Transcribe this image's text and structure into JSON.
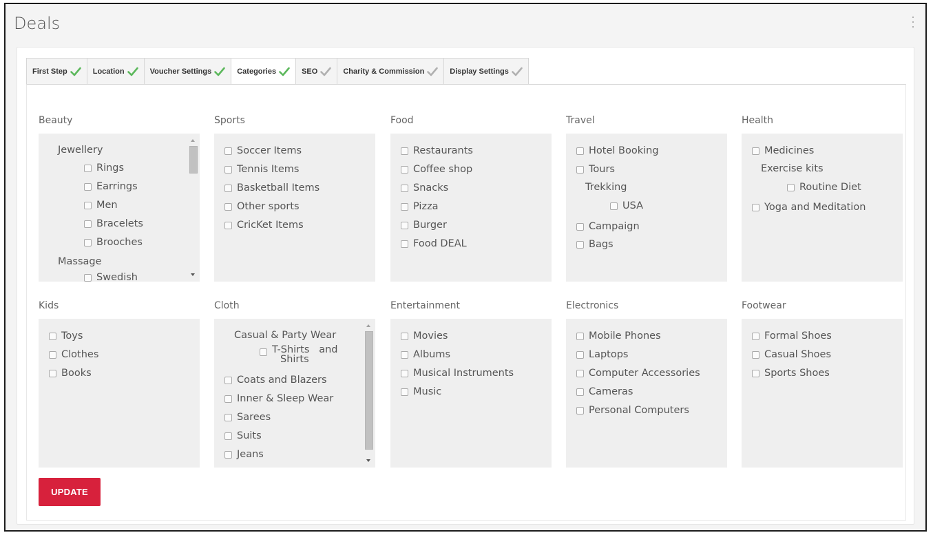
{
  "page": {
    "title": "Deals"
  },
  "tabs": [
    {
      "label": "First Step",
      "status": "complete",
      "active": false
    },
    {
      "label": "Location",
      "status": "complete",
      "active": false
    },
    {
      "label": "Voucher Settings",
      "status": "complete",
      "active": false
    },
    {
      "label": "Categories",
      "status": "complete",
      "active": true
    },
    {
      "label": "SEO",
      "status": "incomplete",
      "active": false
    },
    {
      "label": "Charity & Commission",
      "status": "incomplete",
      "active": false
    },
    {
      "label": "Display Settings",
      "status": "incomplete",
      "active": false
    }
  ],
  "colors": {
    "complete_check": "#5cb85c",
    "incomplete_check": "#b0b0b0",
    "primary_button": "#d7213c"
  },
  "categories": {
    "beauty": {
      "title": "Beauty",
      "group1": "Jewellery",
      "items1": [
        "Rings",
        "Earrings",
        "Men",
        "Bracelets",
        "Brooches"
      ],
      "group2": "Massage",
      "items2": [
        "Swedish"
      ]
    },
    "sports": {
      "title": "Sports",
      "items": [
        "Soccer Items",
        "Tennis Items",
        "Basketball Items",
        "Other sports",
        "CricKet Items"
      ]
    },
    "food": {
      "title": "Food",
      "items": [
        "Restaurants",
        "Coffee shop",
        "Snacks",
        "Pizza",
        "Burger",
        "Food DEAL"
      ]
    },
    "travel": {
      "title": "Travel",
      "items_top": [
        "Hotel Booking",
        "Tours"
      ],
      "group": "Trekking",
      "group_items": [
        "USA"
      ],
      "items_bottom": [
        "Campaign",
        "Bags"
      ]
    },
    "health": {
      "title": "Health",
      "items_top": [
        "Medicines"
      ],
      "group": "Exercise kits",
      "group_items": [
        "Routine Diet"
      ],
      "items_bottom": [
        "Yoga and Meditation"
      ]
    },
    "kids": {
      "title": "Kids",
      "items": [
        "Toys",
        "Clothes",
        "Books"
      ]
    },
    "cloth": {
      "title": "Cloth",
      "group": "Casual & Party Wear",
      "group_item_line1": "T-Shirts   and",
      "group_item_line2": "Shirts",
      "items": [
        "Coats and Blazers",
        "Inner & Sleep Wear",
        "Sarees",
        "Suits",
        "Jeans"
      ]
    },
    "entertainment": {
      "title": "Entertainment",
      "items": [
        "Movies",
        "Albums",
        "Musical Instruments",
        "Music"
      ]
    },
    "electronics": {
      "title": "Electronics",
      "items": [
        "Mobile Phones",
        "Laptops",
        "Computer Accessories",
        "Cameras",
        "Personal Computers"
      ]
    },
    "footwear": {
      "title": "Footwear",
      "items": [
        "Formal Shoes",
        "Casual Shoes",
        "Sports Shoes"
      ]
    }
  },
  "actions": {
    "update_label": "UPDATE"
  }
}
